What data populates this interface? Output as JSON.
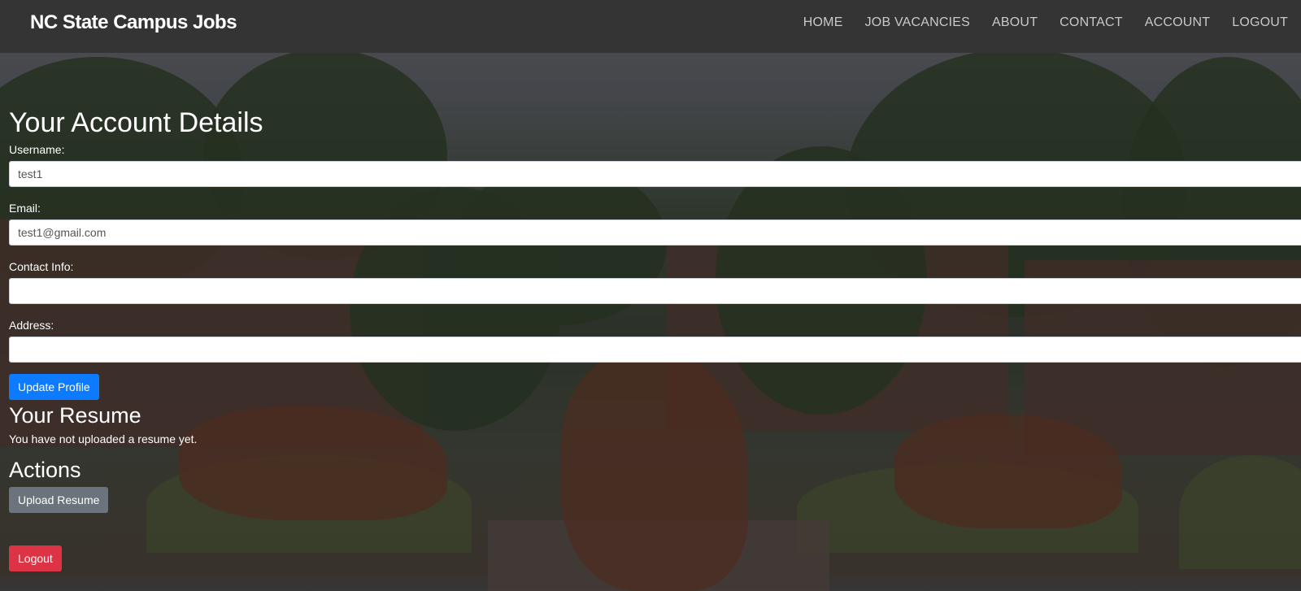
{
  "navbar": {
    "brand": "NC State Campus Jobs",
    "links": [
      "HOME",
      "JOB VACANCIES",
      "ABOUT",
      "CONTACT",
      "ACCOUNT",
      "LOGOUT"
    ]
  },
  "account": {
    "title": "Your Account Details",
    "username_label": "Username:",
    "username_value": "test1",
    "email_label": "Email:",
    "email_value": "test1@gmail.com",
    "contact_label": "Contact Info:",
    "contact_value": "",
    "address_label": "Address:",
    "address_value": "",
    "update_button": "Update Profile"
  },
  "resume": {
    "title": "Your Resume",
    "status": "You have not uploaded a resume yet."
  },
  "actions": {
    "title": "Actions",
    "upload_button": "Upload Resume",
    "logout_button": "Logout"
  },
  "colors": {
    "navbar": "#343434",
    "primary": "#0d7bff",
    "secondary": "#6b747c",
    "danger": "#dc3444"
  }
}
